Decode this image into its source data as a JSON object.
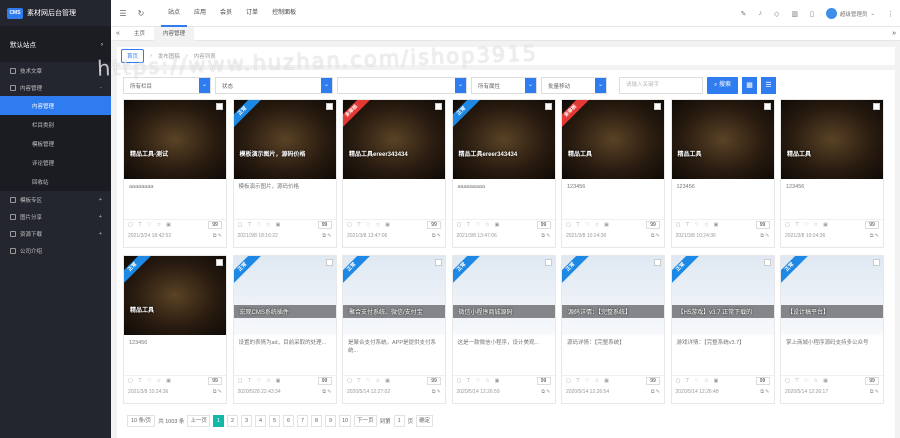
{
  "app": {
    "logo": "CMS",
    "title": "素材网后台管理"
  },
  "sidebar": {
    "site": "默认站点",
    "menus": [
      {
        "label": "技术文章",
        "sign": "+"
      },
      {
        "label": "内容管理",
        "sign": "-"
      },
      {
        "label": "模板专区",
        "sign": "+"
      },
      {
        "label": "图片分享",
        "sign": "+"
      },
      {
        "label": "资源下载",
        "sign": "+"
      },
      {
        "label": "公司介绍",
        "sign": ""
      }
    ],
    "subs": [
      "内容管理",
      "栏目类别",
      "模板管理",
      "评论管理",
      "回收站"
    ]
  },
  "topnav": [
    "站点",
    "应用",
    "会员",
    "订单",
    "控制面板"
  ],
  "user": "超级管理员",
  "tabs": [
    "主页",
    "内容管理"
  ],
  "breadcrumb": [
    "首页",
    "发布图稿",
    "内容列表"
  ],
  "toolbar": {
    "sel1": "所有栏目",
    "sel2": "状态",
    "sel3": "所有属性",
    "sel4": "批量移动",
    "search_placeholder": "请输入关键字",
    "search_btn": "搜索"
  },
  "watermark": "https://www.huzhan.com/ishop3915",
  "cards": [
    {
      "title": "精品工具-测试",
      "desc": "aaaaaaaa",
      "date": "2021/3/24 18:42:52",
      "ribbon": "",
      "count": "99"
    },
    {
      "title": "模板演示图片，源码价格",
      "desc": "模板演示图片，源码价格",
      "date": "2021/3/8 18:16:22",
      "ribbon": "正常",
      "count": "99"
    },
    {
      "title": "精品工具ereer343434",
      "desc": "",
      "date": "2021/3/8 13:47:06",
      "ribbon": "未审核",
      "count": "99"
    },
    {
      "title": "精品工具ereer343434",
      "desc": "aaaaaaaaa",
      "date": "2021/3/8 13:47:06",
      "ribbon": "正常",
      "count": "99"
    },
    {
      "title": "精品工具",
      "desc": "123456",
      "date": "2021/3/8 10:24:36",
      "ribbon": "未审核",
      "count": "99"
    },
    {
      "title": "精品工具",
      "desc": "123456",
      "date": "2021/3/8 10:24:36",
      "ribbon": "",
      "count": "99"
    },
    {
      "title": "精品工具",
      "desc": "123456",
      "date": "2021/3/8 10:24:36",
      "ribbon": "",
      "count": "99"
    },
    {
      "title": "精品工具",
      "desc": "123456",
      "date": "2021/3/8 10:24:36",
      "ribbon": "正常",
      "count": "99"
    },
    {
      "title": "宏观CMS系统插件",
      "desc": "设置的表情为ad，目前采取的处理...",
      "date": "2020/5/28 22:43:34",
      "ribbon": "正常",
      "count": "99"
    },
    {
      "title": "聚合支付系统、微信/支付宝",
      "desc": "是聚合支付系统。APP是提供支付系统...",
      "date": "2020/5/14 12:27:02",
      "ribbon": "正常",
      "count": "99"
    },
    {
      "title": "微信小程序商城源码",
      "desc": "这是一款微信小程序，设计美观...",
      "date": "2020/5/14 12:26:59",
      "ribbon": "正常",
      "count": "99"
    },
    {
      "title": "源码详情：【完整系统】",
      "desc": "源码详情：【完整系统】",
      "date": "2020/5/14 12:26:54",
      "ribbon": "正常",
      "count": "99"
    },
    {
      "title": "【H5游戏】v3.7 正常下载的",
      "desc": "游戏详情：【完整系统v3.7】",
      "date": "2020/5/14 12:26:48",
      "ribbon": "正常",
      "count": "99"
    },
    {
      "title": "【设计稿平台】",
      "desc": "掌上商城小程序源码支持多公众号",
      "date": "2020/5/14 12:26:17",
      "ribbon": "正常",
      "count": "99"
    }
  ],
  "pager": {
    "per": "10 条/页",
    "total": "共 1003 条",
    "prev": "上一页",
    "pages": [
      "1",
      "2",
      "3",
      "4",
      "5",
      "6",
      "7",
      "8",
      "9",
      "10"
    ],
    "next": "下一页",
    "goto": "到第",
    "goto_val": "1",
    "unit": "页",
    "ok": "确定"
  }
}
